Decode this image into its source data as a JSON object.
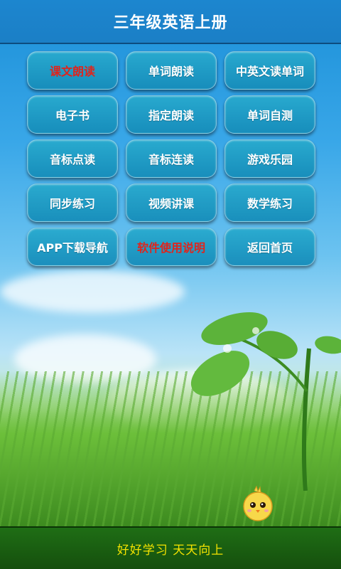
{
  "header": {
    "title": "三年级英语上册"
  },
  "menu": {
    "items": [
      {
        "label": "课文朗读",
        "color": "#e0241c"
      },
      {
        "label": "单词朗读"
      },
      {
        "label": "中英文读单词"
      },
      {
        "label": "电子书"
      },
      {
        "label": "指定朗读"
      },
      {
        "label": "单词自测"
      },
      {
        "label": "音标点读"
      },
      {
        "label": "音标连读"
      },
      {
        "label": "游戏乐园"
      },
      {
        "label": "同步练习"
      },
      {
        "label": "视频讲课"
      },
      {
        "label": "数学练习"
      },
      {
        "label": "APP下载导航"
      },
      {
        "label": "软件使用说明",
        "color": "#e0241c"
      },
      {
        "label": "返回首页"
      }
    ]
  },
  "footer": {
    "text": "好好学习  天天向上"
  },
  "colors": {
    "header": "#1b7fc6",
    "button": "#1f9bc6",
    "accent_red": "#e0241c",
    "footer_text": "#f3e200"
  }
}
